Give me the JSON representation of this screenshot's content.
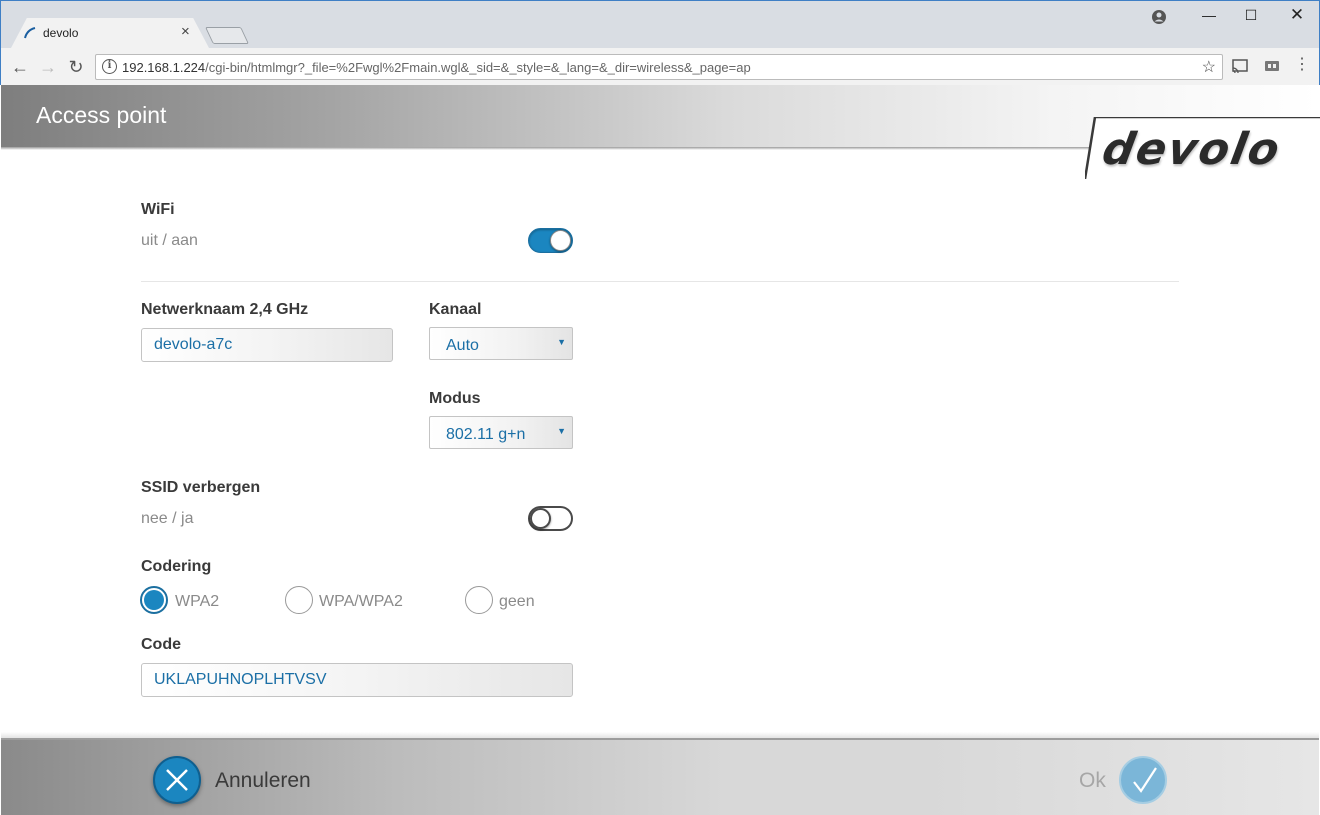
{
  "browser": {
    "tab_title": "devolo",
    "url_host": "192.168.1.224",
    "url_path": "/cgi-bin/htmlmgr?_file=%2Fwgl%2Fmain.wgl&_sid=&_style=&_lang=&_dir=wireless&_page=ap"
  },
  "header": {
    "title": "Access point",
    "logo": "devolo"
  },
  "wifi": {
    "label": "WiFi",
    "toggle_caption": "uit / aan",
    "enabled": true
  },
  "network_name": {
    "label": "Netwerknaam 2,4 GHz",
    "value": "devolo-a7c"
  },
  "channel": {
    "label": "Kanaal",
    "value": "Auto"
  },
  "mode": {
    "label": "Modus",
    "value": "802.11 g+n"
  },
  "hide_ssid": {
    "label": "SSID verbergen",
    "toggle_caption": "nee / ja",
    "enabled": false
  },
  "encryption": {
    "label": "Codering",
    "options": [
      "WPA2",
      "WPA/WPA2",
      "geen"
    ],
    "selected": "WPA2"
  },
  "code": {
    "label": "Code",
    "value": "UKLAPUHNOPLHTVSV"
  },
  "footer": {
    "cancel_label": "Annuleren",
    "ok_label": "Ok"
  },
  "colors": {
    "accent": "#1b86c0",
    "ok_disabled": "#7bb6d8"
  }
}
